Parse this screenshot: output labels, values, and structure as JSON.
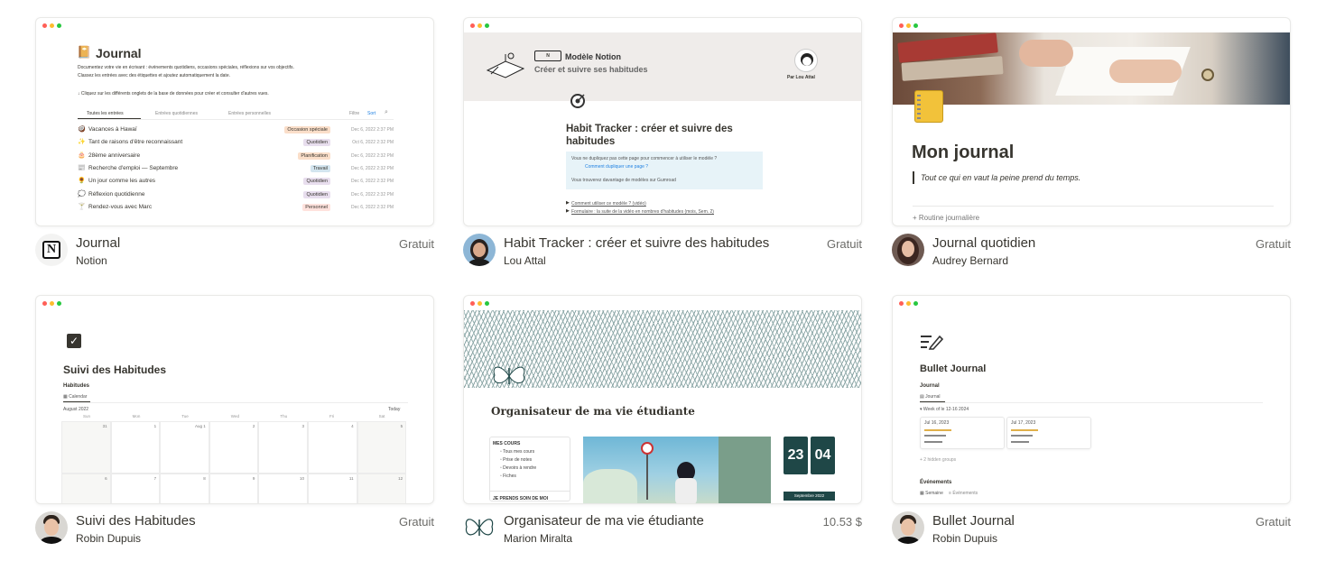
{
  "cards": [
    {
      "name": "Journal",
      "author": "Notion",
      "price": "Gratuit",
      "preview": {
        "title": "Journal",
        "desc1": "Documentez votre vie en écrivant : événements quotidiens, occasions spéciales, réflexions sur vos objectifs.",
        "desc2": "Classez les entrées avec des étiquettes et ajoutez automatiquement la date.",
        "hint": "↓ Cliquez sur les différents onglets de la base de données pour créer et consulter d'autres vues.",
        "tabs": [
          "Toutes les entrées",
          "Entrées quotidiennes",
          "Entrées personnelles"
        ],
        "filter": "Filtre",
        "sort": "Sort",
        "rows": [
          {
            "icon": "🥥",
            "name": "Vacances à Hawaï",
            "tag": "Occasion spéciale",
            "tagcolor": "#fadec9",
            "date": "Dec 6, 2022 2:37 PM"
          },
          {
            "icon": "✨",
            "name": "Tant de raisons d'être reconnaissant",
            "tag": "Quotidien",
            "tagcolor": "#e8deee",
            "date": "Oct 6, 2022 2:32 PM"
          },
          {
            "icon": "🎂",
            "name": "28ème anniversaire",
            "tag": "Planification",
            "tagcolor": "#fadec9",
            "date": "Dec 6, 2022 2:32 PM"
          },
          {
            "icon": "📰",
            "name": "Recherche d'emploi — Septembre",
            "tag": "Travail",
            "tagcolor": "#d3e5ef",
            "date": "Dec 6, 2022 2:32 PM"
          },
          {
            "icon": "🌻",
            "name": "Un jour comme les autres",
            "tag": "Quotidien",
            "tagcolor": "#e8deee",
            "date": "Dec 6, 2022 2:32 PM"
          },
          {
            "icon": "💭",
            "name": "Réflexion quotidienne",
            "tag": "Quotidien",
            "tagcolor": "#e8deee",
            "date": "Dec 6, 2022 2:32 PM"
          },
          {
            "icon": "🍸",
            "name": "Rendez-vous avec Marc",
            "tag": "Personnel",
            "tagcolor": "#ffe2dd",
            "date": "Dec 6, 2022 2:32 PM"
          }
        ]
      }
    },
    {
      "name": "Habit Tracker : créer et suivre des habitudes",
      "author": "Lou Attal",
      "price": "Gratuit",
      "preview": {
        "badge": "Modèle Notion",
        "subtitle": "Créer et suivre ses habitudes",
        "by": "Par Lou Attal",
        "title": "Habit Tracker : créer et suivre des habitudes",
        "callout1": "Vous ne dupliquez pas cette page pour commencer à utiliser le modèle ?",
        "callout2": "Comment dupliquer une page ?",
        "callout3": "Vous trouverez davantage de modèles sur Gumroad",
        "link1": "Comment utiliser ce modèle ? (vidéo)",
        "link2": "Formulaire : la suite de la vidéo en nombres d'habitudes (mois, Sem. 2)"
      }
    },
    {
      "name": "Journal quotidien",
      "author": "Audrey Bernard",
      "price": "Gratuit",
      "preview": {
        "title": "Mon journal",
        "quote": "Tout ce qui en vaut la peine prend du temps.",
        "item": "Routine journalière"
      }
    },
    {
      "name": "Suivi des Habitudes",
      "author": "Robin Dupuis",
      "price": "Gratuit",
      "preview": {
        "title": "Suivi des Habitudes",
        "section": "Habitudes",
        "view": "Calendar",
        "month": "August 2022",
        "today": "Today",
        "days": [
          "Sun",
          "Mon",
          "Tue",
          "Wed",
          "Thu",
          "Fri",
          "Sat"
        ],
        "week1": [
          "31",
          "1",
          "Aug 1",
          "2",
          "3",
          "4",
          "5"
        ],
        "week2": [
          "6",
          "7",
          "8",
          "9",
          "10",
          "11",
          "12"
        ]
      }
    },
    {
      "name": "Organisateur de ma vie étudiante",
      "author": "Marion Miralta",
      "price": "10.53 $",
      "preview": {
        "title": "Organisateur de ma vie étudiante",
        "menu_head": "MES COURS",
        "menu": [
          "Tous mes cours",
          "Prise de notes",
          "Devoirs à rendre",
          "Fiches"
        ],
        "menu_head2": "JE PRENDS SOIN DE MOI",
        "clock_h": "23",
        "clock_m": "04",
        "date": "Septembre 2022"
      }
    },
    {
      "name": "Bullet Journal",
      "author": "Robin Dupuis",
      "price": "Gratuit",
      "preview": {
        "title": "Bullet Journal",
        "section": "Journal",
        "view": "Journal",
        "group": "Week of le 12-16 2024",
        "cardA": "Jul 16, 2023",
        "cardB": "Jul 17, 2023",
        "more": "+ 2 hidden groups",
        "section2": "Événements",
        "view2a": "Semaine",
        "view2b": "Évènements"
      }
    }
  ],
  "colors": {
    "accent_dark_teal": "#1f4747",
    "text": "#37352f",
    "muted": "#6b6b68"
  }
}
